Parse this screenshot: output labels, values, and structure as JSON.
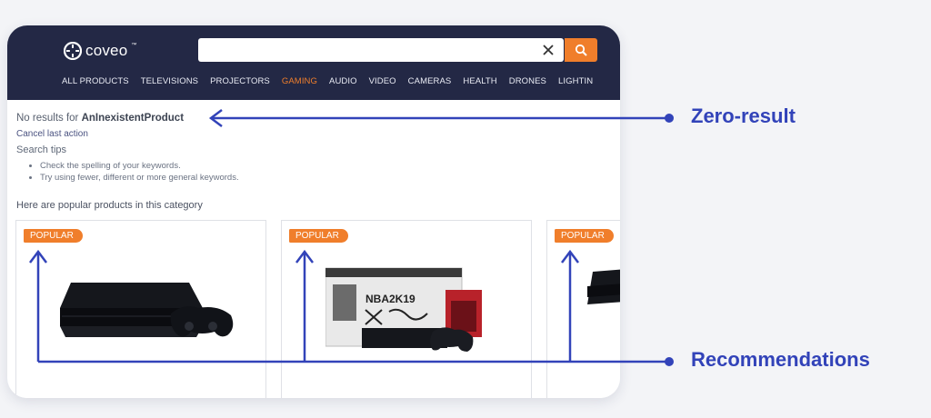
{
  "header": {
    "logo_text": "coveo",
    "logo_tm": "™",
    "search": {
      "value": "",
      "placeholder": ""
    },
    "nav": [
      {
        "label": "ALL PRODUCTS",
        "active": false
      },
      {
        "label": "TELEVISIONS",
        "active": false
      },
      {
        "label": "PROJECTORS",
        "active": false
      },
      {
        "label": "GAMING",
        "active": true
      },
      {
        "label": "AUDIO",
        "active": false
      },
      {
        "label": "VIDEO",
        "active": false
      },
      {
        "label": "CAMERAS",
        "active": false
      },
      {
        "label": "HEALTH",
        "active": false
      },
      {
        "label": "DRONES",
        "active": false
      },
      {
        "label": "LIGHTIN",
        "active": false
      }
    ]
  },
  "results": {
    "no_results_prefix": "No results for ",
    "query": "AnInexistentProduct",
    "cancel_label": "Cancel last action",
    "tips_title": "Search tips",
    "tips": [
      "Check the spelling of your keywords.",
      "Try using fewer, different or more general keywords."
    ],
    "popular_heading": "Here are popular products in this category"
  },
  "cards": [
    {
      "badge": "POPULAR",
      "product": "game-console-black"
    },
    {
      "badge": "POPULAR",
      "product": "console-bundle-box"
    },
    {
      "badge": "POPULAR",
      "product": "game-console-partial"
    }
  ],
  "annotations": {
    "zero_result": "Zero-result",
    "recommendations": "Recommendations",
    "color": "#3243b9"
  },
  "colors": {
    "header_bg": "#232845",
    "accent": "#f07e2b"
  }
}
